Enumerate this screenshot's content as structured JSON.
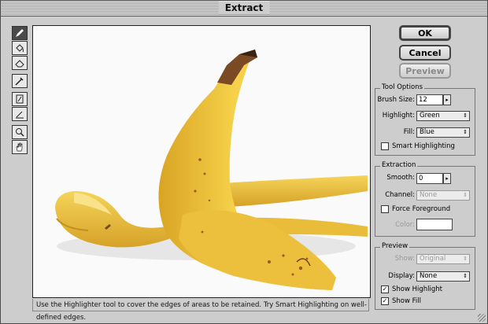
{
  "window": {
    "title": "Extract"
  },
  "buttons": {
    "ok": "OK",
    "cancel": "Cancel",
    "preview": "Preview"
  },
  "status": "Use the Highlighter tool to cover the edges of areas to be retained. Try Smart Highlighting on well-defined edges.",
  "tools": [
    "highlighter-tool",
    "fill-tool",
    "eraser-tool",
    "eyedropper-tool",
    "cleanup-tool",
    "edge-touchup-tool",
    "zoom-tool",
    "hand-tool"
  ],
  "tool_options": {
    "title": "Tool Options",
    "brush_size_label": "Brush Size:",
    "brush_size": "12",
    "highlight_label": "Highlight:",
    "highlight": "Green",
    "fill_label": "Fill:",
    "fill": "Blue",
    "smart_label": "Smart Highlighting",
    "smart_checked": false
  },
  "extraction": {
    "title": "Extraction",
    "smooth_label": "Smooth:",
    "smooth": "0",
    "channel_label": "Channel:",
    "channel": "None",
    "force_label": "Force Foreground",
    "force_checked": false,
    "color_label": "Color:"
  },
  "preview_group": {
    "title": "Preview",
    "show_label": "Show:",
    "show": "Original",
    "display_label": "Display:",
    "display": "None",
    "show_highlight_label": "Show Highlight",
    "show_highlight_checked": true,
    "show_fill_label": "Show Fill",
    "show_fill_checked": true
  },
  "colors": {
    "banana": "#f2c63a",
    "banana_shade": "#d9a424",
    "stem": "#6b3b1c"
  }
}
